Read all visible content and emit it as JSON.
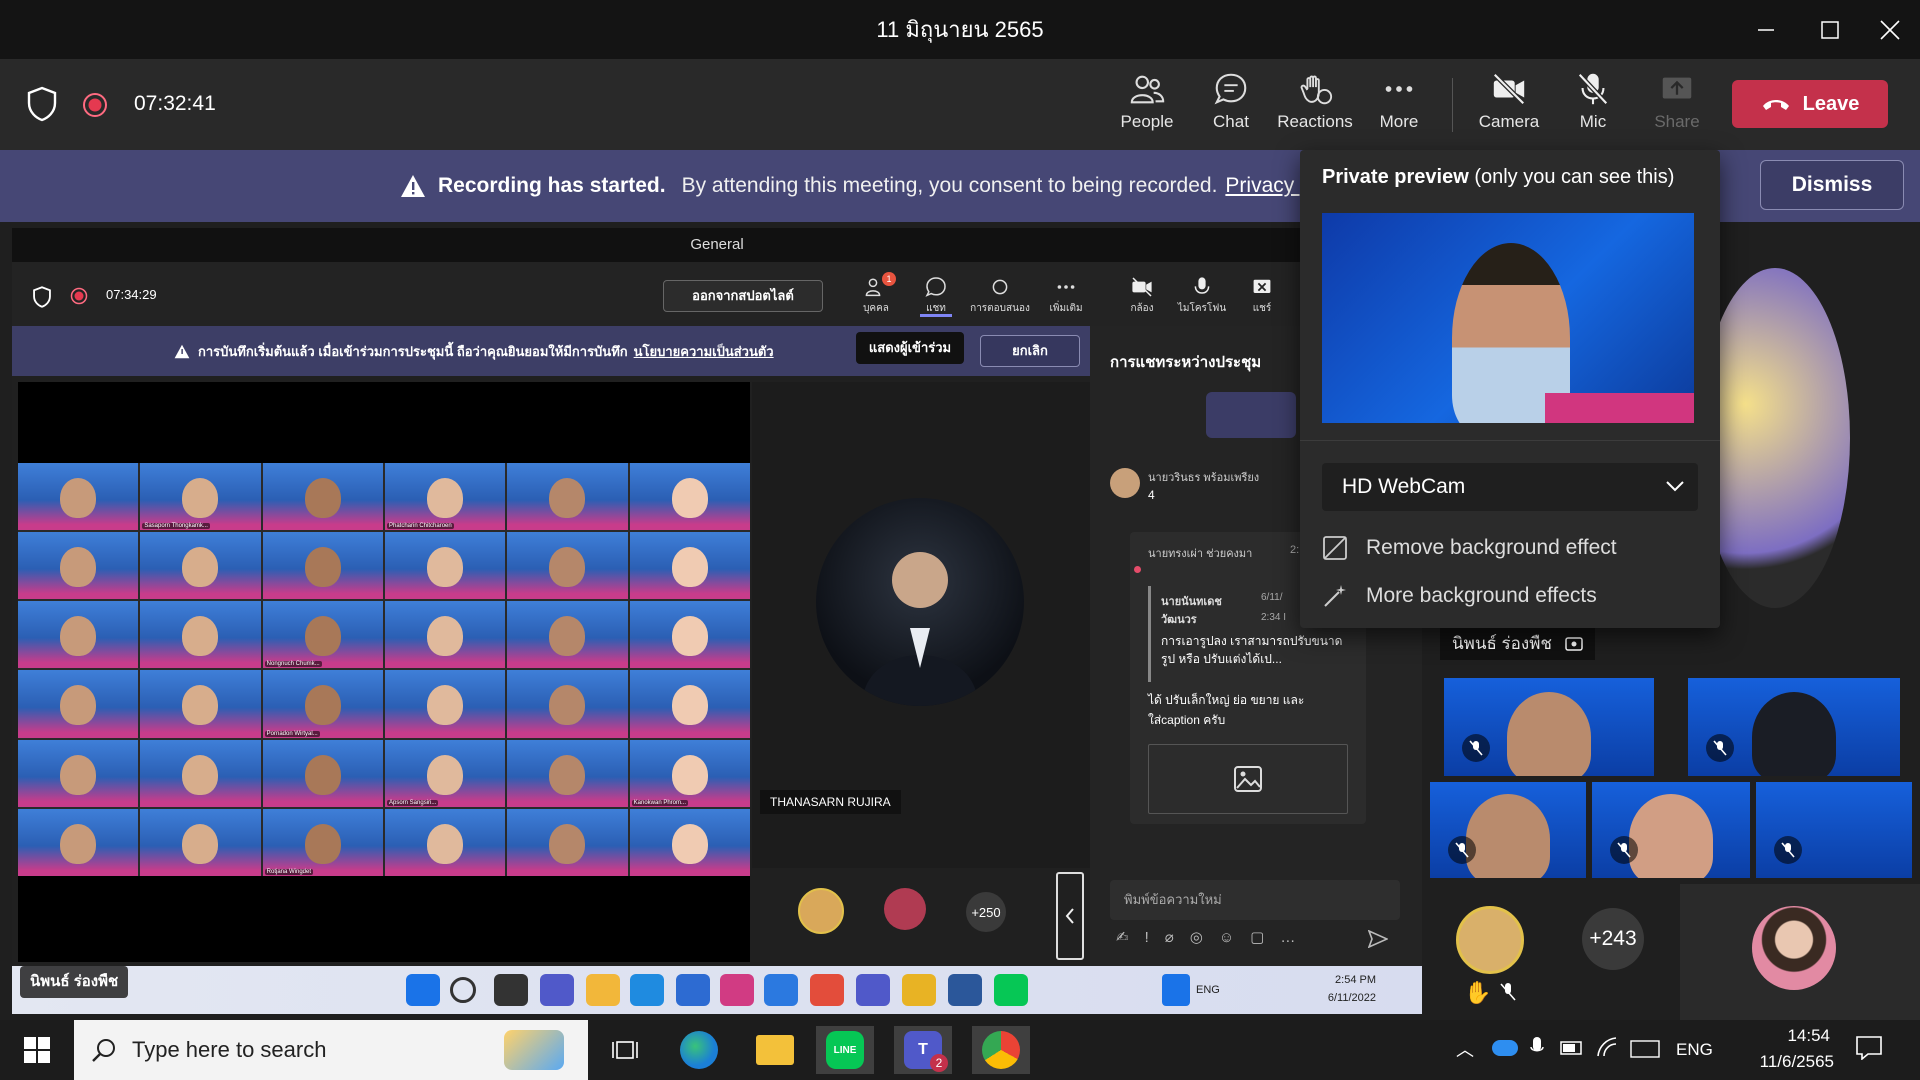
{
  "window": {
    "title": "11 มิถุนายน 2565"
  },
  "toolbar": {
    "timer": "07:32:41",
    "buttons": [
      {
        "label": "People",
        "icon": "people-icon"
      },
      {
        "label": "Chat",
        "icon": "chat-icon"
      },
      {
        "label": "Reactions",
        "icon": "reactions-icon"
      },
      {
        "label": "More",
        "icon": "more-icon"
      },
      {
        "label": "Camera",
        "icon": "camera-off-icon"
      },
      {
        "label": "Mic",
        "icon": "mic-off-icon"
      },
      {
        "label": "Share",
        "icon": "share-icon"
      }
    ],
    "leave_label": "Leave"
  },
  "banner": {
    "title": "Recording has started.",
    "text": "By attending this meeting, you consent to being recorded.",
    "link": "Privacy p",
    "dismiss_label": "Dismiss"
  },
  "inner": {
    "title": "General",
    "timer": "07:34:29",
    "leave_label": "ออกจากสปอตไลต์",
    "buttons": [
      "บุคคล",
      "แชท",
      "การตอบสนอง",
      "เพิ่มเติม",
      "กล้อง",
      "ไมโครโฟน",
      "แชร์"
    ],
    "people_badge": "1",
    "banner_text": "การบันทึกเริ่มต้นแล้ว  เมื่อเข้าร่วมการประชุมนี้ ถือว่าคุณยินยอมให้มีการบันทึก",
    "banner_link": "นโยบายความเป็นส่วนตัว",
    "show_participants": "แสดงผู้เข้าร่วม",
    "cancel_label": "ยกเลิก",
    "speaker_name": "THANASARN RUJIRA",
    "overflow_count": "+250",
    "chat": {
      "header": "การแชทระหว่างประชุม",
      "msg1_author": "นายวรินธร พร้อมเพรียง",
      "msg1_text": "4",
      "msg2_author": "นายทรงเผ่า ช่วยคงมา",
      "msg2_time": "2:",
      "quote_author": "นายนันทเดช วัฒนวร",
      "quote_date": "6/11/",
      "quote_time": "2:34 I",
      "quote_text": "การเอารูปลง เราสามารถปรับขนาดรูป หรือ ปรับแต่งได้เป...",
      "reply": "ได้ ปรับเล็กใหญ่ ย่อ ขยาย และ ใส่caption ครับ",
      "compose_placeholder": "พิมพ์ข้อความใหม่"
    },
    "taskbar": {
      "lang": "ENG",
      "time": "2:54 PM",
      "date": "6/11/2022"
    },
    "name_tag": "นิพนธ์ ร่องพืช"
  },
  "gallery_names": [
    "",
    "Sasaporn Thongkamk...",
    "",
    "Phatcharin Chitcharoen",
    "",
    "",
    "",
    "",
    "",
    "",
    "",
    "",
    "",
    "",
    "Nongnuch Chumk...",
    "",
    "",
    "",
    "",
    "",
    "Pornadon Wirtyal...",
    "",
    "",
    "",
    "",
    "",
    "",
    "Apsorn Sangsiri...",
    "",
    "Kanokwan Phrom...",
    "",
    "",
    "Rotjana Wingdet",
    "",
    "",
    ""
  ],
  "preview": {
    "header_bold": "Private preview",
    "header_rest": "(only you can see this)",
    "camera": "HD WebCam",
    "remove_bg": "Remove background effect",
    "more_bg": "More background effects"
  },
  "right": {
    "spotlight_name": "นิพนธ์ ร่องพืช",
    "overflow_count": "+243"
  },
  "taskbar": {
    "search_placeholder": "Type here to search",
    "lang": "ENG",
    "time": "14:54",
    "date": "11/6/2565",
    "teams_badge": "2"
  }
}
